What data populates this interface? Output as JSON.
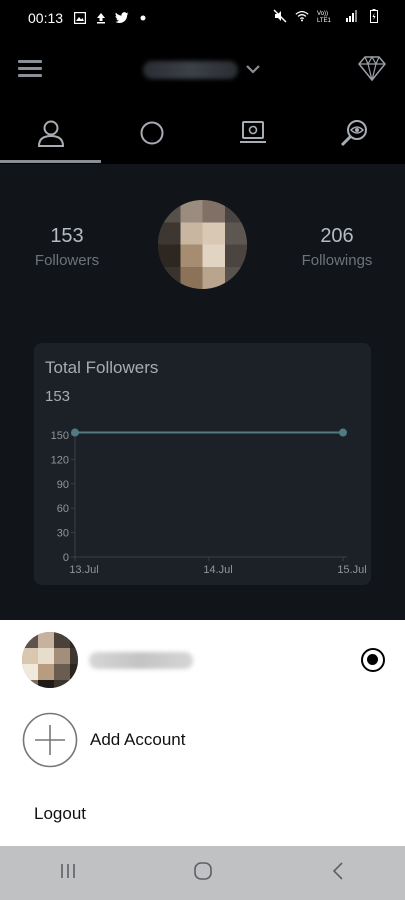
{
  "status_bar": {
    "time": "00:13",
    "left_icons": [
      "image-icon",
      "upload-icon",
      "twitter-icon",
      "dot-icon"
    ],
    "right_icons": [
      "mute-icon",
      "wifi-icon",
      "volte-icon",
      "signal-icon",
      "battery-icon"
    ],
    "volte_label": "Vo))\nLTE1"
  },
  "header": {
    "menu_icon": "hamburger-icon",
    "account_dropdown_icon": "chevron-down-icon",
    "premium_icon": "diamond-icon"
  },
  "tabs": [
    {
      "icon": "profile-icon",
      "active": true
    },
    {
      "icon": "circle-icon",
      "active": false
    },
    {
      "icon": "laptop-account-icon",
      "active": false
    },
    {
      "icon": "search-eye-icon",
      "active": false
    }
  ],
  "profile": {
    "followers_count": "153",
    "followers_label": "Followers",
    "followings_count": "206",
    "followings_label": "Followings"
  },
  "chart_card": {
    "title": "Total Followers",
    "current_value": "153"
  },
  "chart_data": {
    "type": "line",
    "x": [
      "13.Jul",
      "14.Jul",
      "15.Jul"
    ],
    "series": [
      {
        "values": [
          153,
          153,
          153
        ]
      }
    ],
    "yticks": [
      0,
      30,
      60,
      90,
      120,
      150
    ],
    "ylim": [
      0,
      150
    ],
    "grid": false,
    "line_color": "#4f7c83"
  },
  "account_sheet": {
    "add_account_label": "Add Account",
    "logout_label": "Logout"
  },
  "nav_bar": {
    "buttons": [
      "recent-apps-icon",
      "home-icon",
      "back-icon"
    ]
  }
}
